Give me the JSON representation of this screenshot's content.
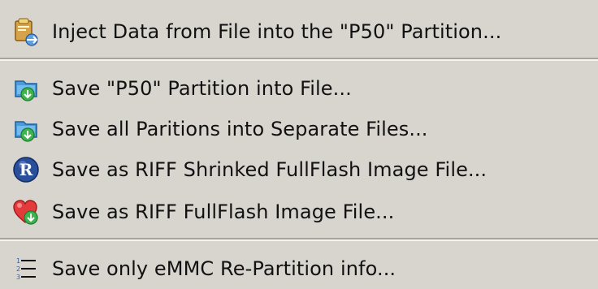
{
  "menu": {
    "items": [
      {
        "label": "Inject Data from File into the \"P50\" Partition...",
        "icon": "clipboard-inject-icon"
      },
      {
        "label": "Save \"P50\" Partition into File...",
        "icon": "save-partition-icon"
      },
      {
        "label": "Save all Paritions into Separate Files...",
        "icon": "save-all-partitions-icon"
      },
      {
        "label": "Save as RIFF Shrinked FullFlash Image File...",
        "icon": "riff-r-icon",
        "icon_text": "R"
      },
      {
        "label": "Save as RIFF FullFlash Image File...",
        "icon": "heart-save-icon"
      },
      {
        "label": "Save only eMMC Re-Partition info...",
        "icon": "numbered-list-icon",
        "icon_text": [
          "1",
          "2",
          "3"
        ]
      }
    ]
  },
  "colors": {
    "background": "#d8d5cf",
    "separator_dark": "#a6a39d",
    "separator_light": "#f6f5f3",
    "text": "#111111"
  }
}
